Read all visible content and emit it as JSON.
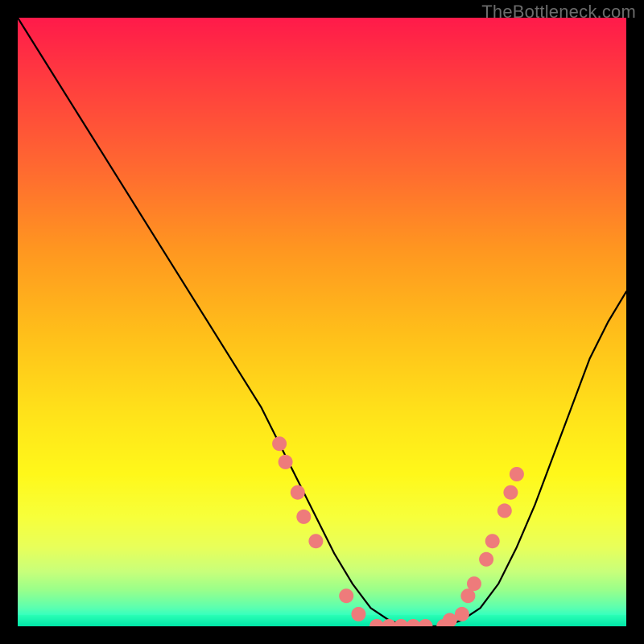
{
  "attribution": "TheBottleneck.com",
  "chart_data": {
    "type": "line",
    "title": "",
    "xlabel": "",
    "ylabel": "",
    "xlim": [
      0,
      100
    ],
    "ylim": [
      0,
      100
    ],
    "series": [
      {
        "name": "bottleneck-curve",
        "x": [
          0,
          5,
          10,
          15,
          20,
          25,
          30,
          35,
          40,
          43,
          46,
          49,
          52,
          55,
          58,
          61,
          64,
          67,
          70,
          73,
          76,
          79,
          82,
          85,
          88,
          91,
          94,
          97,
          100
        ],
        "values": [
          100,
          92,
          84,
          76,
          68,
          60,
          52,
          44,
          36,
          30,
          24,
          18,
          12,
          7,
          3,
          1,
          0,
          0,
          0,
          1,
          3,
          7,
          13,
          20,
          28,
          36,
          44,
          50,
          55
        ]
      }
    ],
    "markers": [
      {
        "x": 43,
        "y": 30
      },
      {
        "x": 44,
        "y": 27
      },
      {
        "x": 46,
        "y": 22
      },
      {
        "x": 47,
        "y": 18
      },
      {
        "x": 49,
        "y": 14
      },
      {
        "x": 54,
        "y": 5
      },
      {
        "x": 56,
        "y": 2
      },
      {
        "x": 59,
        "y": 0
      },
      {
        "x": 61,
        "y": 0
      },
      {
        "x": 63,
        "y": 0
      },
      {
        "x": 65,
        "y": 0
      },
      {
        "x": 67,
        "y": 0
      },
      {
        "x": 70,
        "y": 0
      },
      {
        "x": 71,
        "y": 1
      },
      {
        "x": 73,
        "y": 2
      },
      {
        "x": 74,
        "y": 5
      },
      {
        "x": 75,
        "y": 7
      },
      {
        "x": 77,
        "y": 11
      },
      {
        "x": 78,
        "y": 14
      },
      {
        "x": 80,
        "y": 19
      },
      {
        "x": 81,
        "y": 22
      },
      {
        "x": 82,
        "y": 25
      }
    ],
    "marker_color": "#ee7b7b",
    "curve_color": "#000000",
    "background": "rainbow-vertical-gradient"
  }
}
